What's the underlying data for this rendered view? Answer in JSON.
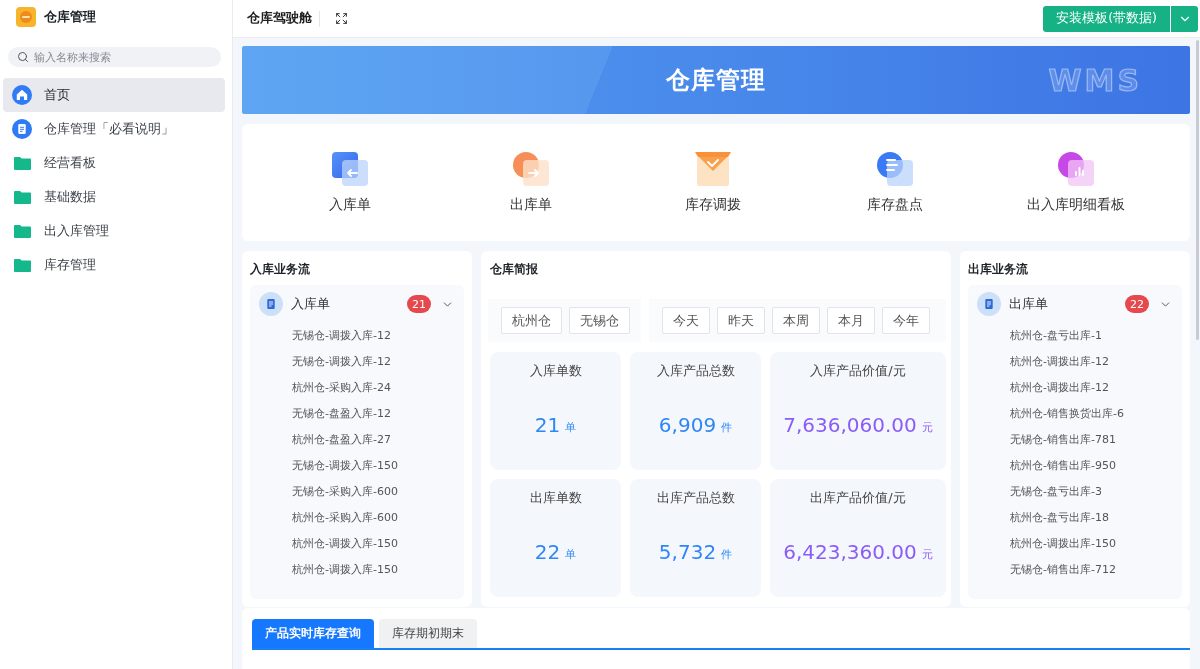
{
  "sidebar": {
    "app_title": "仓库管理",
    "search": {
      "placeholder": "输入名称来搜索"
    },
    "items": [
      {
        "label": "首页",
        "kind": "home",
        "selected": true
      },
      {
        "label": "仓库管理「必看说明」",
        "kind": "doc",
        "selected": false
      },
      {
        "label": "经营看板",
        "kind": "folder",
        "selected": false
      },
      {
        "label": "基础数据",
        "kind": "folder",
        "selected": false
      },
      {
        "label": "出入库管理",
        "kind": "folder",
        "selected": false
      },
      {
        "label": "库存管理",
        "kind": "folder",
        "selected": false
      }
    ]
  },
  "topbar": {
    "title": "仓库驾驶舱",
    "install_button": "安装模板(带数据)"
  },
  "banner": {
    "title": "仓库管理",
    "logo_text": "WMS"
  },
  "quick_entries": [
    {
      "label": "入库单",
      "kind": "inbound"
    },
    {
      "label": "出库单",
      "kind": "outbound"
    },
    {
      "label": "库存调拨",
      "kind": "transfer"
    },
    {
      "label": "库存盘点",
      "kind": "stocktake"
    },
    {
      "label": "出入库明细看板",
      "kind": "dashboard"
    }
  ],
  "inbound_flow": {
    "title": "入库业务流",
    "group": {
      "label": "入库单",
      "count": "21",
      "expanded": true,
      "items": [
        "无锡仓-调拨入库-12",
        "无锡仓-调拨入库-12",
        "杭州仓-采购入库-24",
        "无锡仓-盘盈入库-12",
        "杭州仓-盘盈入库-27",
        "无锡仓-调拨入库-150",
        "无锡仓-采购入库-600",
        "杭州仓-采购入库-600",
        "杭州仓-调拨入库-150",
        "杭州仓-调拨入库-150"
      ]
    }
  },
  "briefing": {
    "title": "仓库简报",
    "warehouses": [
      {
        "label": "杭州仓",
        "selected": false
      },
      {
        "label": "无锡仓",
        "selected": false
      }
    ],
    "periods": [
      {
        "label": "今天",
        "selected": false
      },
      {
        "label": "昨天",
        "selected": false
      },
      {
        "label": "本周",
        "selected": false
      },
      {
        "label": "本月",
        "selected": false
      },
      {
        "label": "今年",
        "selected": false
      }
    ],
    "stats": [
      {
        "label": "入库单数",
        "value": "21",
        "unit": "单",
        "kind": "count"
      },
      {
        "label": "入库产品总数",
        "value": "6,909",
        "unit": "件",
        "kind": "count"
      },
      {
        "label": "入库产品价值/元",
        "value": "7,636,060.00",
        "unit": "元",
        "kind": "amount"
      },
      {
        "label": "出库单数",
        "value": "22",
        "unit": "单",
        "kind": "count"
      },
      {
        "label": "出库产品总数",
        "value": "5,732",
        "unit": "件",
        "kind": "count"
      },
      {
        "label": "出库产品价值/元",
        "value": "6,423,360.00",
        "unit": "元",
        "kind": "amount"
      }
    ]
  },
  "outbound_flow": {
    "title": "出库业务流",
    "group": {
      "label": "出库单",
      "count": "22",
      "expanded": true,
      "items": [
        "杭州仓-盘亏出库-1",
        "杭州仓-调拨出库-12",
        "杭州仓-调拨出库-12",
        "杭州仓-销售换货出库-6",
        "无锡仓-销售出库-781",
        "杭州仓-销售出库-950",
        "无锡仓-盘亏出库-3",
        "杭州仓-盘亏出库-18",
        "杭州仓-调拨出库-150",
        "无锡仓-销售出库-712"
      ]
    }
  },
  "bottom_tabs": [
    {
      "label": "产品实时库存查询",
      "selected": true
    },
    {
      "label": "库存期初期末",
      "selected": false
    }
  ]
}
